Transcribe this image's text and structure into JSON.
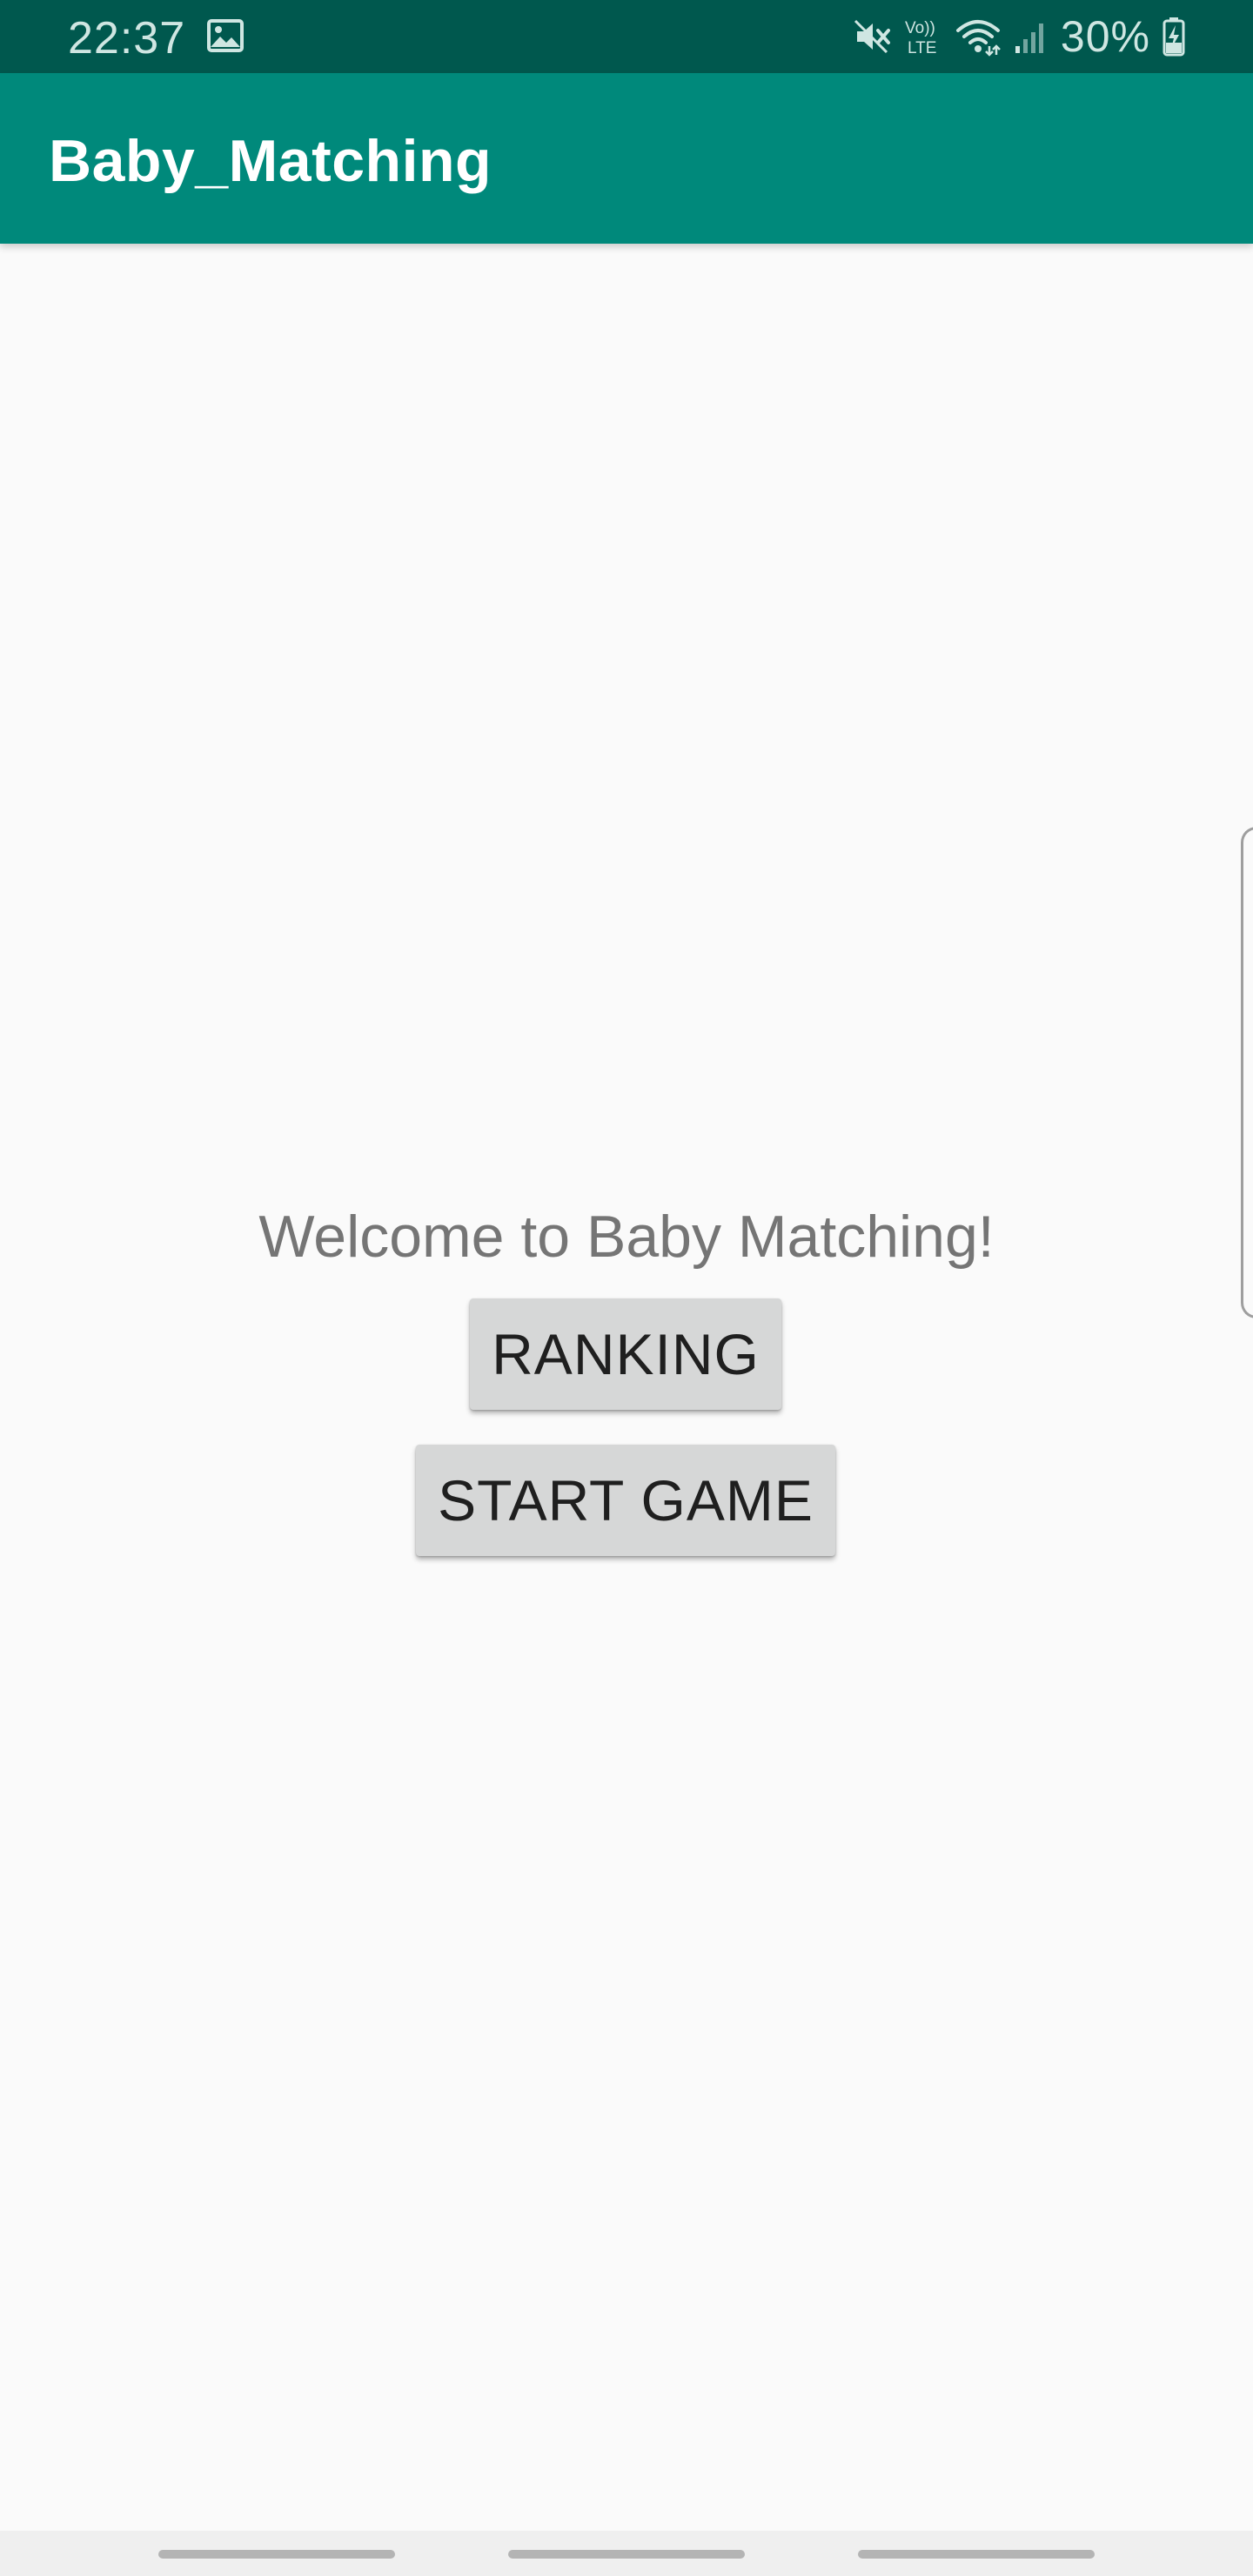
{
  "status_bar": {
    "time": "22:37",
    "icons": [
      "image-icon",
      "mute-icon",
      "volte-icon",
      "wifi-icon",
      "signal-icon",
      "battery-charging-icon"
    ],
    "volte_top": "Vo))",
    "volte_bottom": "LTE",
    "battery": "30%"
  },
  "app_bar": {
    "title": "Baby_Matching",
    "color": "#00897b",
    "status_color": "#00584e"
  },
  "main": {
    "welcome": "Welcome to Baby Matching!",
    "ranking_label": "RANKING",
    "start_label": "START GAME"
  },
  "nav_bar": {
    "items": [
      "recent-apps",
      "home",
      "back"
    ]
  }
}
